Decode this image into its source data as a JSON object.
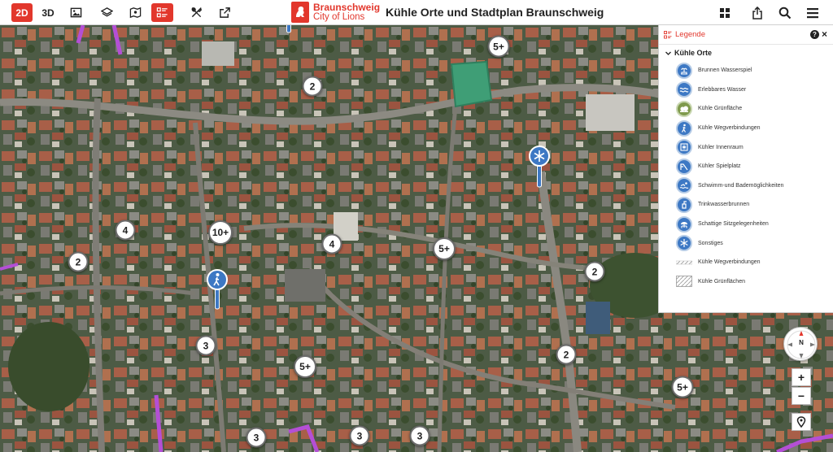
{
  "toolbar": {
    "mode_2d": "2D",
    "mode_3d": "3D",
    "active_color": "#e2372c"
  },
  "brand": {
    "name": "Braunschweig",
    "subtitle": "City of Lions"
  },
  "app_title": "Kühle Orte und Stadtplan Braunschweig",
  "legend": {
    "title": "Legende",
    "help": "?",
    "close": "×",
    "section": "Kühle Orte",
    "items": [
      {
        "label": "Brunnen Wasserspiel",
        "icon": "fountain-icon"
      },
      {
        "label": "Erlebbares Wasser",
        "icon": "water-icon"
      },
      {
        "label": "Kühle Grünfläche",
        "icon": "green-area-icon"
      },
      {
        "label": "Kühle Wegverbindungen",
        "icon": "walker-icon"
      },
      {
        "label": "Kühler Innenraum",
        "icon": "indoor-icon"
      },
      {
        "label": "Kühler Spielplatz",
        "icon": "playground-icon"
      },
      {
        "label": "Schwimm-und Bademöglichkeiten",
        "icon": "swim-icon"
      },
      {
        "label": "Trinkwasserbrunnen",
        "icon": "drinking-water-icon"
      },
      {
        "label": "Schattige Sitzgelegenheiten",
        "icon": "shaded-seat-icon"
      },
      {
        "label": "Sonstiges",
        "icon": "snowflake-icon"
      },
      {
        "label": "Kühle Wegverbindungen",
        "icon": "path-swatch"
      },
      {
        "label": "Kühle Grünflächen",
        "icon": "area-swatch"
      }
    ]
  },
  "clusters": [
    "5+",
    "2",
    "4",
    "10+",
    "4",
    "5+",
    "2",
    "2",
    "3",
    "5+",
    "2",
    "5+",
    "3",
    "3",
    "3"
  ],
  "compass_label": "N",
  "zoom_in": "+",
  "zoom_out": "−"
}
